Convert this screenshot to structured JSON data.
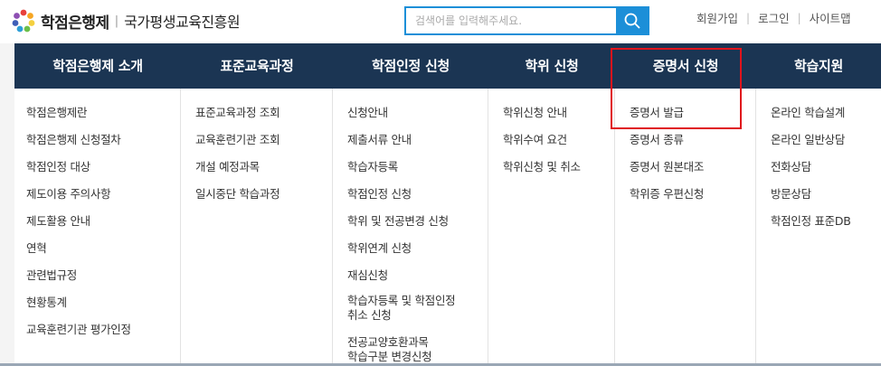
{
  "header": {
    "logo_main": "학점은행제",
    "logo_divider": "|",
    "logo_sub": "국가평생교육진흥원",
    "search_placeholder": "검색어를 입력해주세요.",
    "util": [
      {
        "label": "회원가입"
      },
      {
        "label": "로그인"
      },
      {
        "label": "사이트맵"
      }
    ]
  },
  "nav": [
    {
      "label": "학점은행제 소개"
    },
    {
      "label": "표준교육과정"
    },
    {
      "label": "학점인정 신청"
    },
    {
      "label": "학위 신청"
    },
    {
      "label": "증명서 신청"
    },
    {
      "label": "학습지원"
    }
  ],
  "menu": [
    {
      "items": [
        "학점은행제란",
        "학점은행제 신청절차",
        "학점인정 대상",
        "제도이용 주의사항",
        "제도활용 안내",
        "연혁",
        "관련법규정",
        "현황통계",
        "교육훈련기관 평가인정"
      ]
    },
    {
      "items": [
        "표준교육과정 조회",
        "교육훈련기관 조회",
        "개설 예정과목",
        "일시중단 학습과정"
      ]
    },
    {
      "items": [
        "신청안내",
        "제출서류 안내",
        "학습자등록",
        "학점인정 신청",
        "학위 및 전공변경 신청",
        "학위연계 신청",
        "재심신청",
        "학습자등록 및 학점인정\n취소 신청",
        "전공교양호환과목\n학습구분 변경신청"
      ]
    },
    {
      "items": [
        "학위신청 안내",
        "학위수여 요건",
        "학위신청 및 취소"
      ]
    },
    {
      "items": [
        "증명서 발급",
        "증명서 종류",
        "증명서 원본대조",
        "학위증 우편신청"
      ]
    },
    {
      "items": [
        "온라인 학습설계",
        "온라인 일반상담",
        "전화상담",
        "방문상담",
        "학점인정 표준DB"
      ]
    }
  ],
  "colors": {
    "nav_bg": "#1b3553",
    "search_accent": "#1c8fd8",
    "highlight": "#e0141c"
  }
}
